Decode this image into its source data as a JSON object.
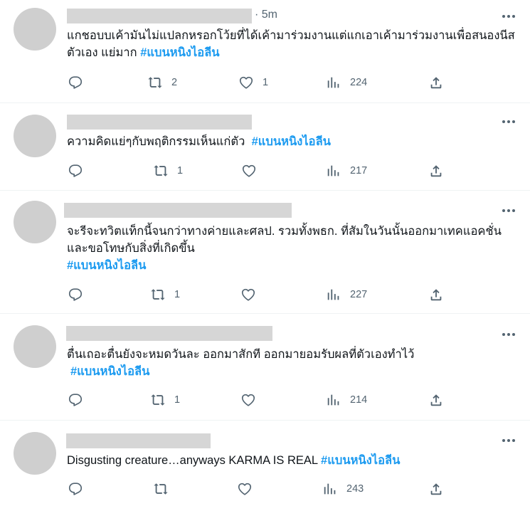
{
  "tweets": [
    {
      "time": "5m",
      "text": "แกชอบบเค้ามันไม่แปลกหรอกโว้ยที่ได้เค้ามาร่วมงานแต่แกเอาเค้ามาร่วมงานเพื่อสนองนีสตัวเอง แย่มาก ",
      "hashtag": "#แบนหนิงไอลีน",
      "retweets": "2",
      "likes": "1",
      "views": "224"
    },
    {
      "text": "ความคิดแย่ๆกับพฤติกรรมเห็นแก่ตัว  ",
      "hashtag": "#แบนหนิงไอลีน",
      "retweets": "1",
      "likes": "",
      "views": "217"
    },
    {
      "text": "จะรีจะทวิตแท็กนี้จนกว่าทางค่ายและศลป. รวมทั้งพธก. ที่สัมในวันนั้นออกมาเทคแอคชั่นและขอโทษกับสิ่งที่เกิดขึ้น",
      "hashtag": "#แบนหนิงไอลีน",
      "retweets": "1",
      "likes": "",
      "views": "227"
    },
    {
      "text": "ตื่นเถอะตื่นยังจะหมดวันละ ออกมาสักที ออกมายอมรับผลที่ตัวเองทำไว้",
      "hashtag": "#แบนหนิงไอลีน",
      "retweets": "1",
      "likes": "",
      "views": "214"
    },
    {
      "text": "Disgusting creature…anyways KARMA IS REAL ",
      "hashtag": "#แบนหนิงไอลีน",
      "retweets": "",
      "likes": "",
      "views": "243"
    }
  ],
  "colors": {
    "hashtag": "#1d9bf0",
    "muted": "#536471",
    "divider": "#eff3f4"
  },
  "icons": [
    "more-icon",
    "reply-icon",
    "retweet-icon",
    "like-icon",
    "views-icon",
    "share-icon"
  ]
}
